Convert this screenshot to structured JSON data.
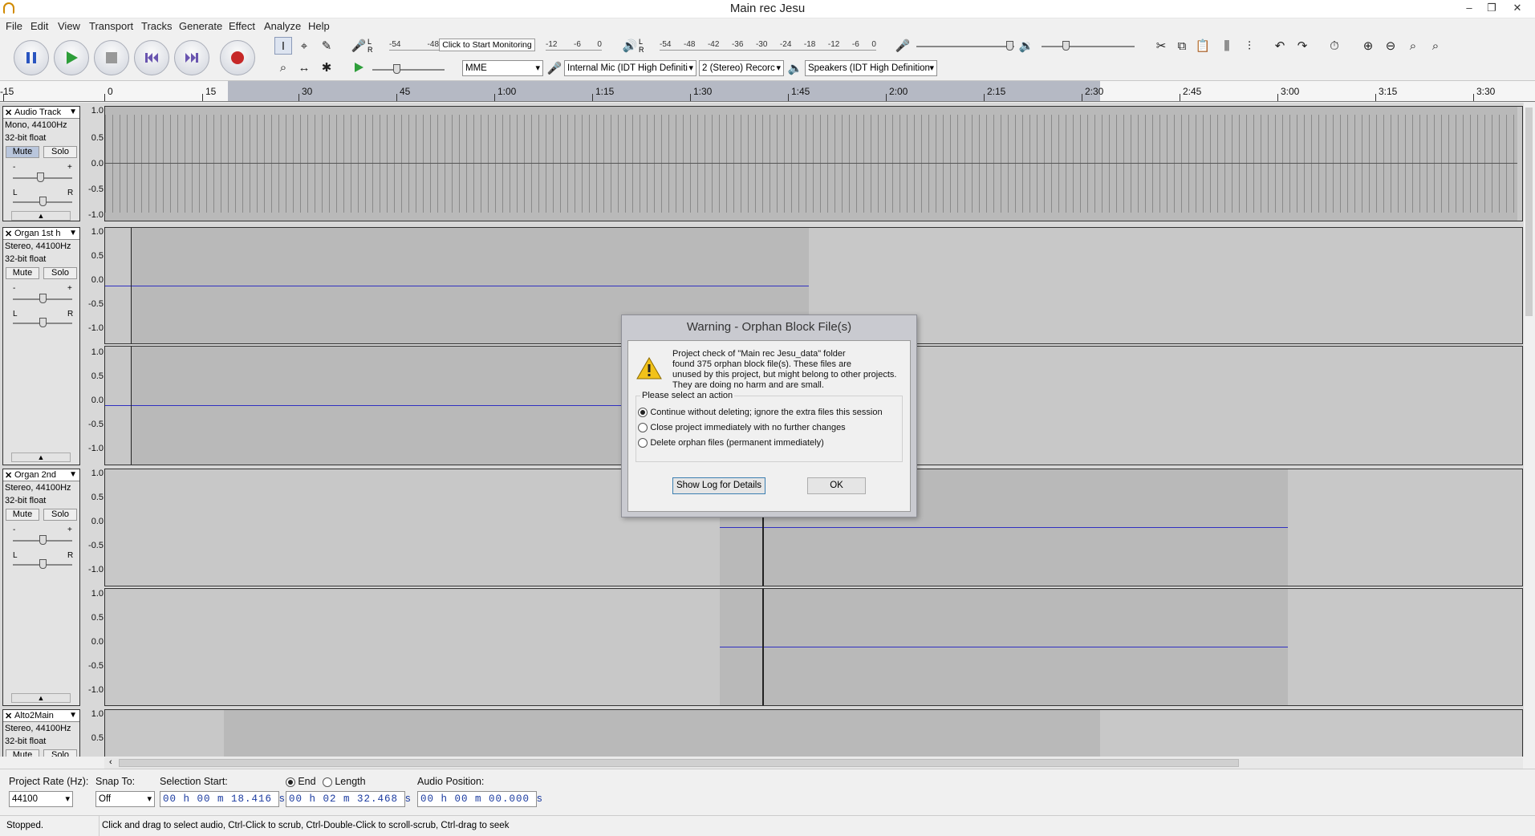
{
  "window": {
    "title": "Main rec Jesu",
    "minimize": "–",
    "restore": "❐",
    "close": "✕"
  },
  "menu": [
    "File",
    "Edit",
    "View",
    "Transport",
    "Tracks",
    "Generate",
    "Effect",
    "Analyze",
    "Help"
  ],
  "meters": {
    "record_ticks": [
      "-54",
      "-48",
      "-12",
      "-6",
      "0"
    ],
    "monitor_label": "Click to Start Monitoring",
    "playback_ticks": [
      "-54",
      "-48",
      "-42",
      "-36",
      "-30",
      "-24",
      "-18",
      "-12",
      "-6",
      "0"
    ],
    "channel_left": "L",
    "channel_right": "R"
  },
  "device": {
    "host": "MME",
    "input": "Internal Mic (IDT High Definiti",
    "channels": "2 (Stereo) Recorc",
    "output": "Speakers (IDT High Definition"
  },
  "ruler": {
    "ticks": [
      "-15",
      "0",
      "15",
      "30",
      "45",
      "1:00",
      "1:15",
      "1:30",
      "1:45",
      "2:00",
      "2:15",
      "2:30",
      "2:45",
      "3:00",
      "3:15",
      "3:30"
    ]
  },
  "scale": {
    "top": "1.0",
    "mid_hi": "0.5",
    "zero": "0.0",
    "mid_lo": "-0.5",
    "bottom": "-1.0"
  },
  "tracks": [
    {
      "name": "Audio Track",
      "rate": "Mono, 44100Hz",
      "format": "32-bit float",
      "mute": "Mute",
      "solo": "Solo",
      "muted": true
    },
    {
      "name": "Organ 1st h",
      "rate": "Stereo, 44100Hz",
      "format": "32-bit float",
      "mute": "Mute",
      "solo": "Solo",
      "muted": false
    },
    {
      "name": "Organ 2nd",
      "rate": "Stereo, 44100Hz",
      "format": "32-bit float",
      "mute": "Mute",
      "solo": "Solo",
      "muted": false
    },
    {
      "name": "Alto2Main",
      "rate": "Stereo, 44100Hz",
      "format": "32-bit float",
      "mute": "Mute",
      "solo": "Solo",
      "muted": false
    }
  ],
  "gain_minus": "-",
  "gain_plus": "+",
  "pan_left": "L",
  "pan_right": "R",
  "selection_bar": {
    "rate_label": "Project Rate (Hz):",
    "rate_value": "44100",
    "snap_label": "Snap To:",
    "snap_value": "Off",
    "sel_start_label": "Selection Start:",
    "end_label": "End",
    "length_label": "Length",
    "sel_start": "00 h 00 m 18.416 s",
    "sel_end": "00 h 02 m 32.468 s",
    "audio_pos_label": "Audio Position:",
    "audio_pos": "00 h 00 m 00.000 s"
  },
  "status": {
    "state": "Stopped.",
    "hint": "Click and drag to select audio, Ctrl-Click to scrub, Ctrl-Double-Click to scroll-scrub, Ctrl-drag to seek"
  },
  "dialog": {
    "title": "Warning - Orphan Block File(s)",
    "line1": "Project check of \"Main rec Jesu_data\" folder",
    "line2": "found 375 orphan block file(s). These files are",
    "line3": "unused by this project, but might belong to other projects.",
    "line4": "They are doing no harm and are small.",
    "group_label": "Please select an action",
    "option1": "Continue without deleting; ignore the extra files this session",
    "option2": "Close project immediately with no further changes",
    "option3": "Delete orphan files (permanent immediately)",
    "show_log": "Show Log for Details",
    "ok": "OK"
  },
  "colors": {
    "waveform_line": "#3030c0",
    "selection": "#b5b9c4",
    "record": "#c62828",
    "play": "#2e9e3a"
  }
}
